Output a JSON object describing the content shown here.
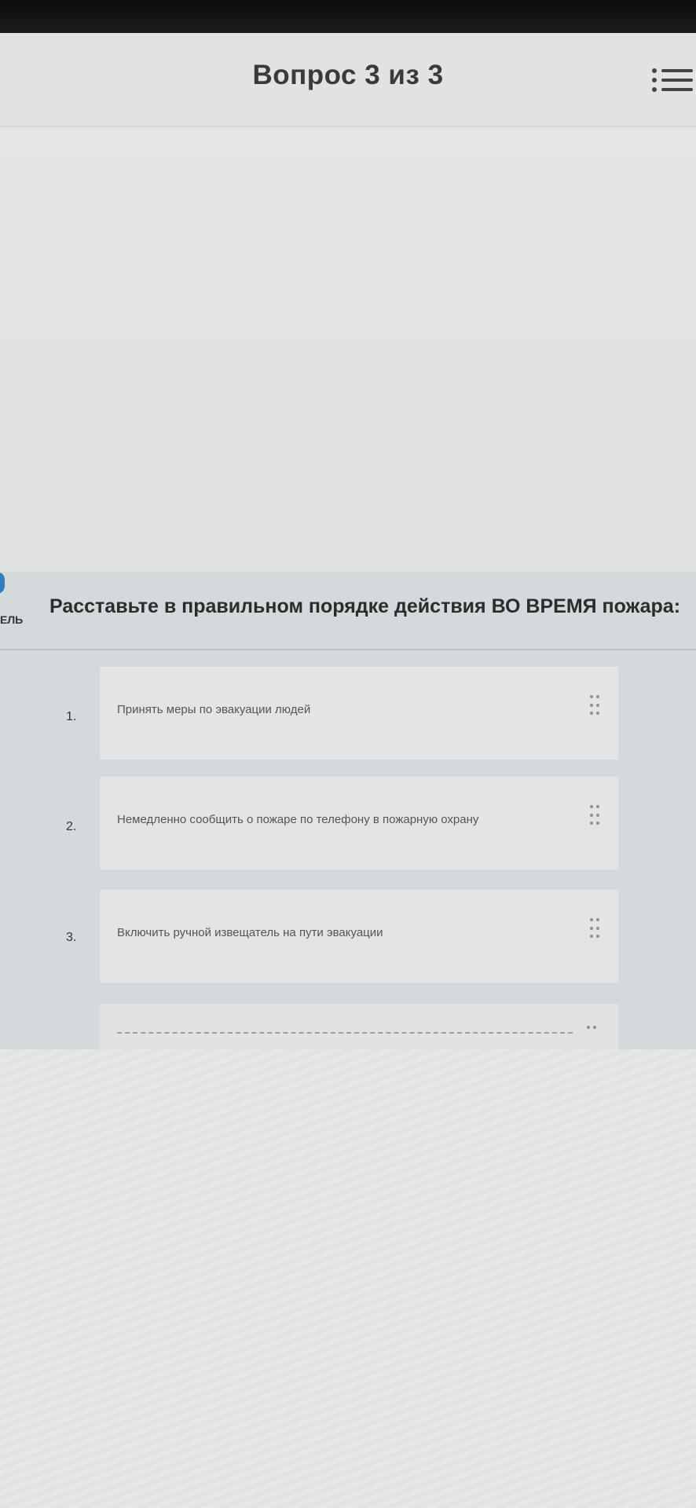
{
  "header": {
    "title": "Вопрос 3 из 3"
  },
  "sidebar": {
    "partial_label": "ЕЛЬ"
  },
  "question": {
    "text": "Расставьте в правильном порядке действия ВО ВРЕМЯ пожара:"
  },
  "items": [
    {
      "number": "1.",
      "text": "Принять меры по эвакуации людей"
    },
    {
      "number": "2.",
      "text": "Немедленно сообщить о пожаре по телефону в пожарную охрану"
    },
    {
      "number": "3.",
      "text": "Включить ручной извещатель на пути эвакуации"
    }
  ],
  "icons": {
    "menu": "list-menu-icon",
    "drag": "drag-handle-icon"
  },
  "colors": {
    "accent": "#2f7fc0"
  }
}
